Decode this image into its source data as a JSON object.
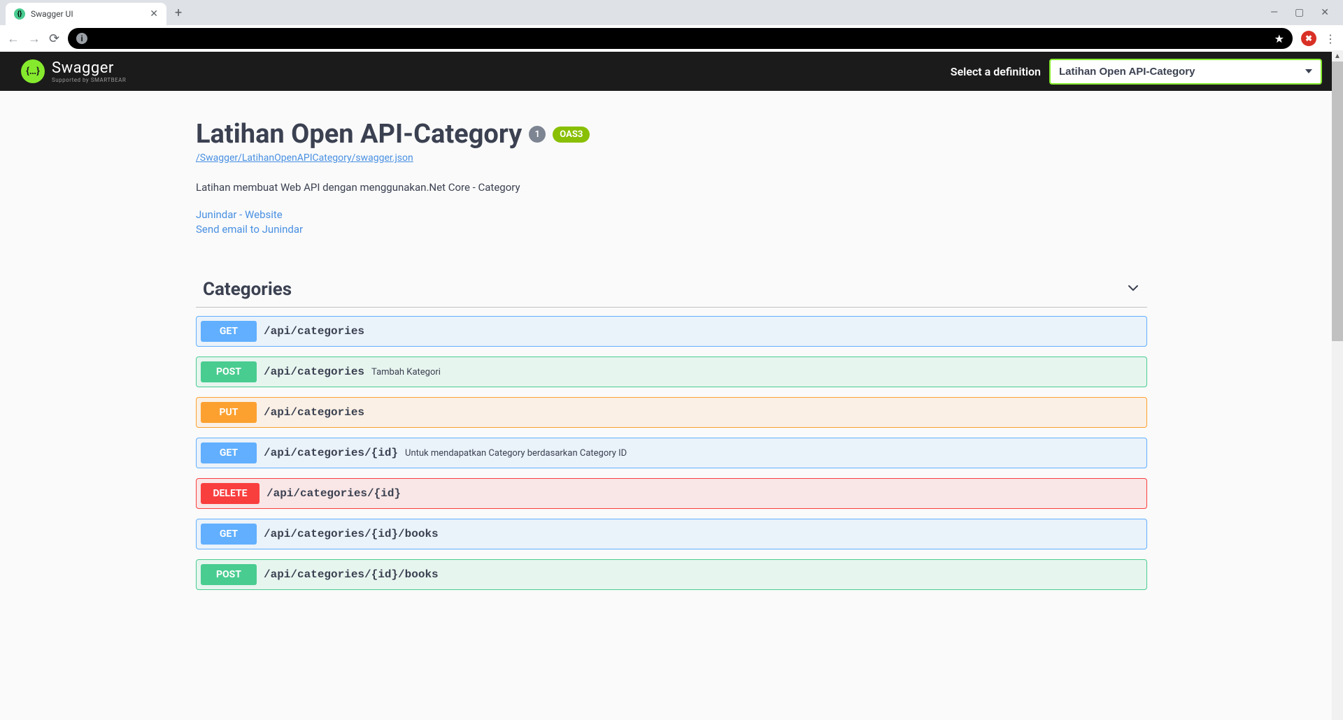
{
  "browser": {
    "tab_title": "Swagger UI",
    "url_masked": "",
    "window_controls": {
      "min": "—",
      "max": "▢",
      "close": "✕"
    }
  },
  "topbar": {
    "logo_main": "Swagger",
    "logo_sub": "Supported by SMARTBEAR",
    "def_label": "Select a definition",
    "def_value": "Latihan Open API-Category"
  },
  "info": {
    "title": "Latihan Open API-Category",
    "version": "1",
    "oas": "OAS3",
    "spec_url": "/Swagger/LatihanOpenAPICategory/swagger.json",
    "description": "Latihan membuat Web API dengan menggunakan.Net Core - Category",
    "contact_website": "Junindar - Website",
    "contact_email": "Send email to Junindar"
  },
  "tag": {
    "name": "Categories"
  },
  "ops": [
    {
      "method": "GET",
      "path": "/api/categories",
      "summary": ""
    },
    {
      "method": "POST",
      "path": "/api/categories",
      "summary": "Tambah Kategori"
    },
    {
      "method": "PUT",
      "path": "/api/categories",
      "summary": ""
    },
    {
      "method": "GET",
      "path": "/api/categories/{id}",
      "summary": "Untuk mendapatkan Category berdasarkan Category ID"
    },
    {
      "method": "DELETE",
      "path": "/api/categories/{id}",
      "summary": ""
    },
    {
      "method": "GET",
      "path": "/api/categories/{id}/books",
      "summary": ""
    },
    {
      "method": "POST",
      "path": "/api/categories/{id}/books",
      "summary": ""
    }
  ]
}
